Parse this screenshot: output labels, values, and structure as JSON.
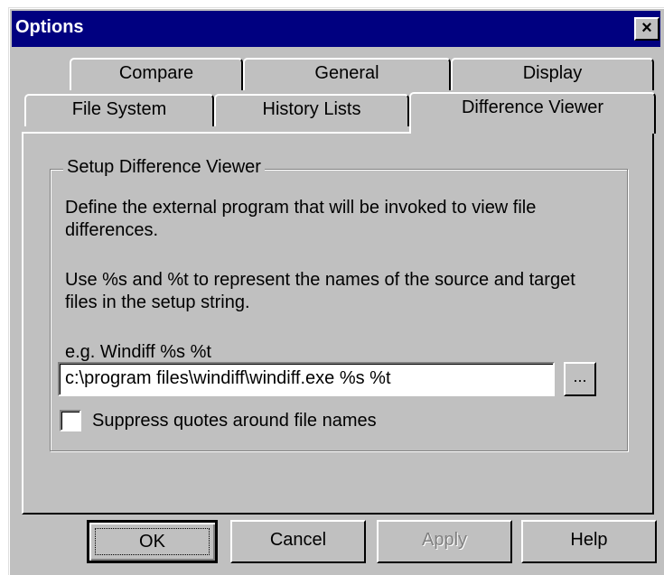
{
  "window": {
    "title": "Options",
    "close_icon": "×"
  },
  "tabs": {
    "row_back": [
      {
        "label": "Compare"
      },
      {
        "label": "General"
      },
      {
        "label": "Display"
      }
    ],
    "row_front": [
      {
        "label": "File System"
      },
      {
        "label": "History Lists"
      },
      {
        "label": "Difference Viewer"
      }
    ],
    "selected": "Difference Viewer"
  },
  "panel": {
    "group_label": "Setup Difference Viewer",
    "description_1_line1": "Define the external program that will be invoked to view file",
    "description_1_line2": "differences.",
    "description_2_line1": "Use %s and %t to represent the names of the source and target",
    "description_2_line2": "files in the setup string.",
    "example": "e.g. Windiff %s %t",
    "command_value": "c:\\program files\\windiff\\windiff.exe %s %t",
    "browse_label": "...",
    "suppress_quotes_label": "Suppress quotes around file names",
    "suppress_quotes_checked": false
  },
  "buttons": {
    "ok": "OK",
    "cancel": "Cancel",
    "apply": "Apply",
    "help": "Help"
  }
}
